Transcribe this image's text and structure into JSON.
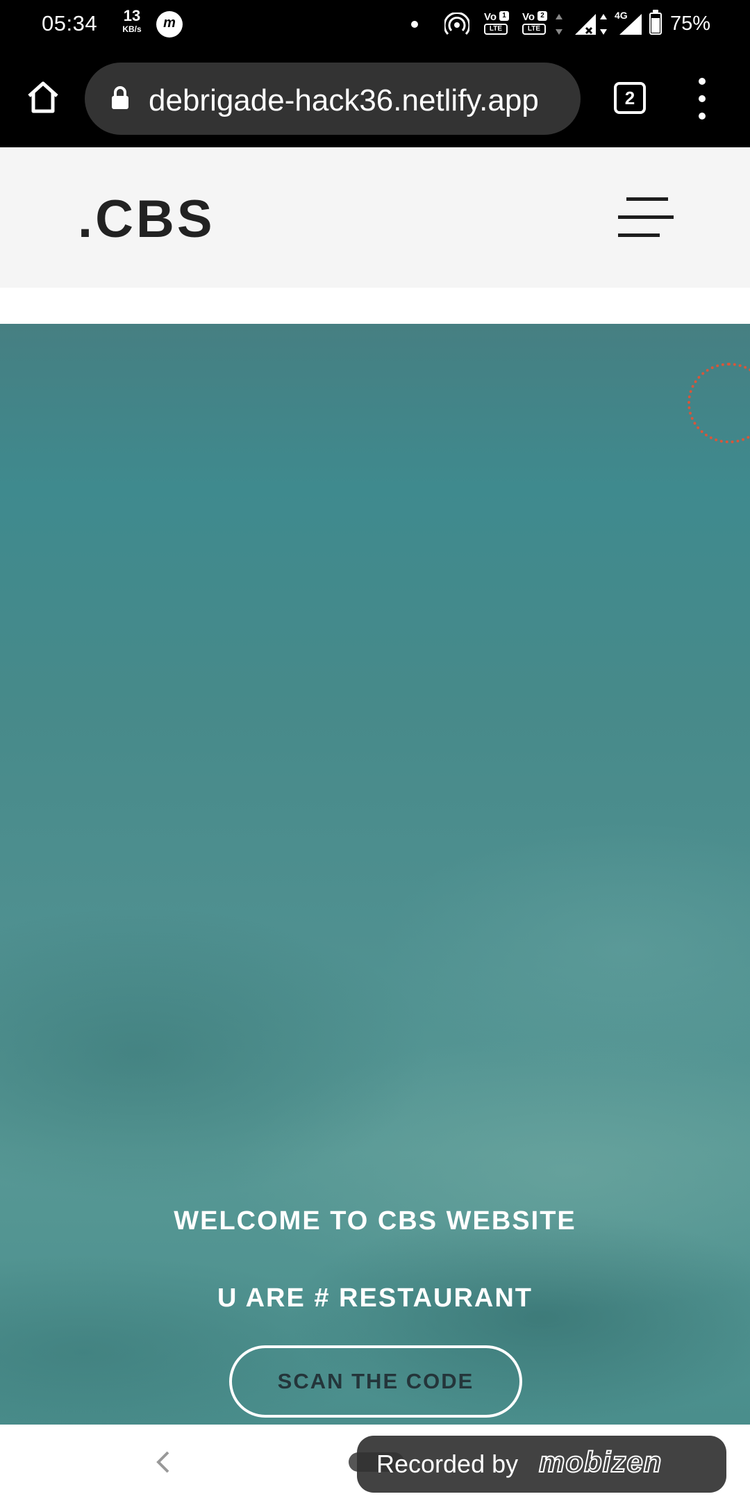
{
  "status_bar": {
    "time": "05:34",
    "net_speed_value": "13",
    "net_speed_unit": "KB/s",
    "mobizen_badge": "m",
    "volte1_label": "Vo",
    "volte1_sim": "1",
    "volte1_lte": "LTE",
    "volte2_label": "Vo",
    "volte2_sim": "2",
    "volte2_lte": "LTE",
    "network_type": "4G",
    "battery_level": 0.75,
    "battery_percent": "75%"
  },
  "browser": {
    "url": "debrigade-hack36.netlify.app",
    "tab_count": "2",
    "icons": [
      "home-icon",
      "lock-icon",
      "tab-switcher-icon",
      "more-vert-icon"
    ]
  },
  "site": {
    "brand": ".CBS",
    "menu_icon": "hamburger-menu-icon"
  },
  "hero": {
    "title": "WELCOME TO CBS WEBSITE",
    "subtitle": "U ARE # RESTAURANT",
    "button_label": "SCAN THE CODE",
    "loader_color": "#d8563a"
  },
  "navigation": {
    "back_icon": "back-arrow-icon"
  },
  "overlay": {
    "recorded_label": "Recorded by",
    "recorded_logo": "mobizen"
  },
  "colors": {
    "header_bg": "#f5f5f5",
    "hero_bg": "#4a8e8c",
    "urlbar_bg": "#333333"
  }
}
